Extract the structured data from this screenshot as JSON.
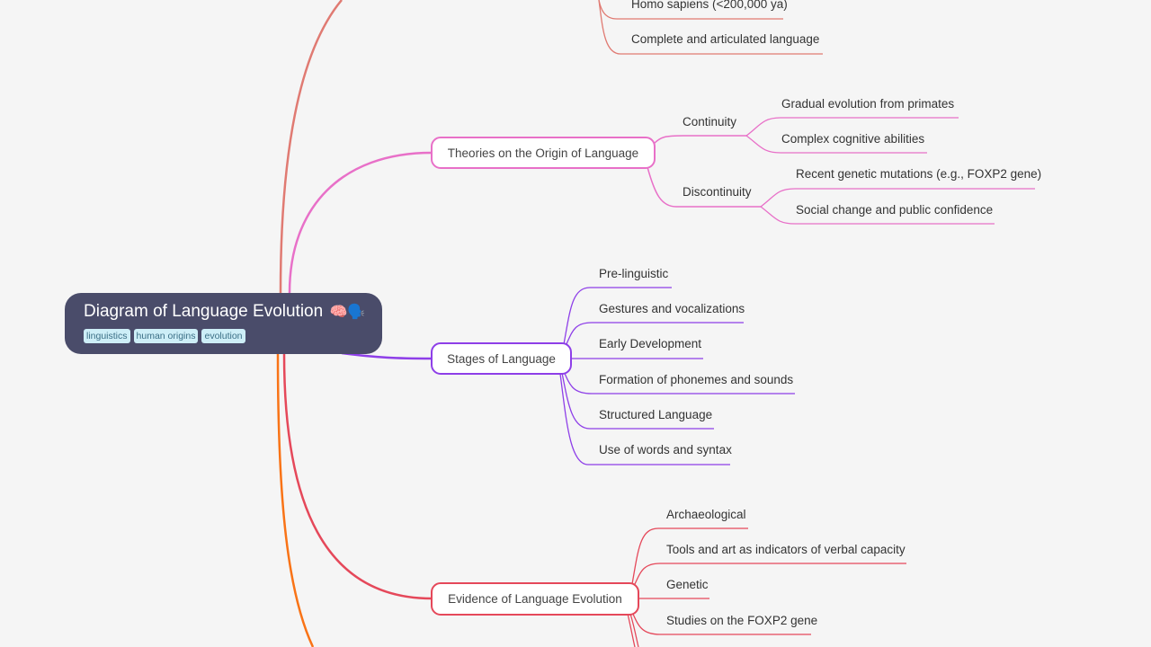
{
  "root": {
    "title": "Diagram of Language Evolution",
    "emoji": "🧠🗣️",
    "tags": [
      "linguistics",
      "human origins",
      "evolution"
    ]
  },
  "colors": {
    "background": "#f5f5f5",
    "root_fill": "#4a4c6a",
    "tag_fill": "#cdeef7",
    "branch_top": "#e07a72",
    "theories": "#e870c8",
    "stages": "#8e3fe8",
    "evidence": "#e5485a",
    "branch_bottom": "#f97316"
  },
  "branches": {
    "top": {
      "leaves": [
        "Homo sapiens (<200,000 ya)",
        "Complete and articulated language"
      ]
    },
    "theories": {
      "label": "Theories on the Origin of Language",
      "sub": [
        {
          "label": "Continuity",
          "leaves": [
            "Gradual evolution from primates",
            "Complex cognitive abilities"
          ]
        },
        {
          "label": "Discontinuity",
          "leaves": [
            "Recent genetic mutations (e.g., FOXP2 gene)",
            "Social change and public confidence"
          ]
        }
      ]
    },
    "stages": {
      "label": "Stages of Language",
      "leaves": [
        "Pre-linguistic",
        "Gestures and vocalizations",
        "Early Development",
        "Formation of phonemes and sounds",
        "Structured Language",
        "Use of words and syntax"
      ]
    },
    "evidence": {
      "label": "Evidence of Language Evolution",
      "leaves": [
        "Archaeological",
        "Tools and art as indicators of verbal capacity",
        "Genetic",
        "Studies on the FOXP2 gene"
      ]
    }
  }
}
